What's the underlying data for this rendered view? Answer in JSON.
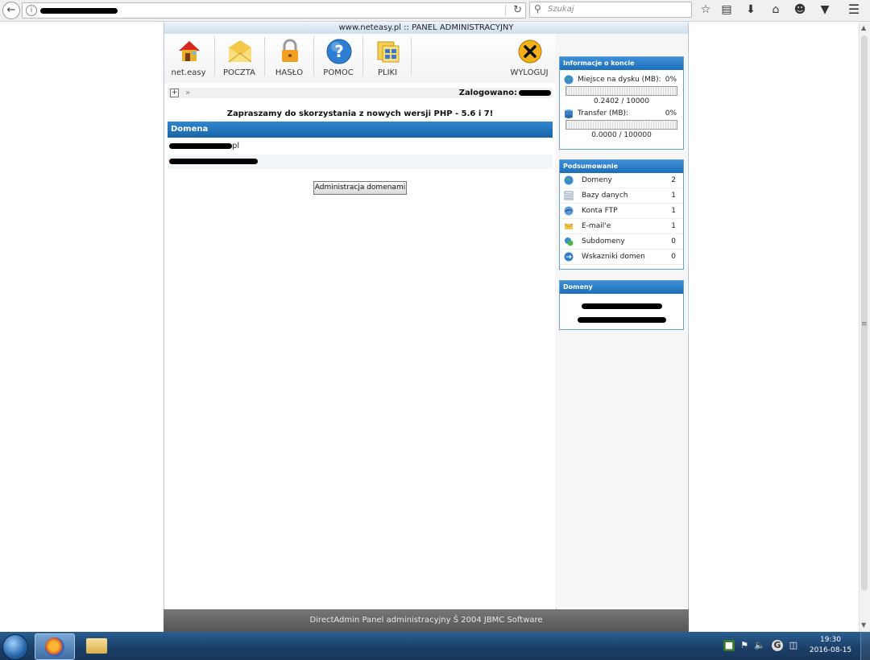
{
  "browser": {
    "search_placeholder": "Szukaj"
  },
  "panel": {
    "header": "www.neteasy.pl :: PANEL ADMINISTRACYJNY",
    "toolbar": {
      "neteasy": "net.easy",
      "mail": "POCZTA",
      "password": "HASŁO",
      "help": "POMOC",
      "files": "PLIKI",
      "logout": "WYLOGUJ"
    },
    "breadcrumb_arrow": "»",
    "logged_in": "Zalogowano:",
    "promo": "Zapraszamy do skorzystania z nowych wersji PHP - 5.6 i 7!",
    "domain_header": "Domena",
    "domain_suffix": "pl",
    "admin_button": "Administracja domenami"
  },
  "sidebar": {
    "account_info": {
      "title": "Informacje o koncie",
      "disk_label": "Miejsce na dysku (MB):",
      "disk_pct": "0%",
      "disk_fill": 0,
      "disk_value": "0.2402 / 10000",
      "transfer_label": "Transfer (MB):",
      "transfer_pct": "0%",
      "transfer_fill": 0,
      "transfer_value": "0.0000 / 100000"
    },
    "summary": {
      "title": "Podsumowanie",
      "items": [
        {
          "name": "Domeny",
          "count": "2",
          "icon": "globe-icon"
        },
        {
          "name": "Bazy danych",
          "count": "1",
          "icon": "database-icon"
        },
        {
          "name": "Konta FTP",
          "count": "1",
          "icon": "ftp-icon"
        },
        {
          "name": "E-mail'e",
          "count": "1",
          "icon": "email-icon"
        },
        {
          "name": "Subdomeny",
          "count": "0",
          "icon": "subdomain-icon"
        },
        {
          "name": "Wskazniki domen",
          "count": "0",
          "icon": "domain-pointer-icon"
        }
      ]
    },
    "domains": {
      "title": "Domeny"
    }
  },
  "footer": "DirectAdmin Panel administracyjny Š 2004 JBMC Software",
  "taskbar": {
    "time": "19:30",
    "date": "2016-08-15"
  },
  "colors": {
    "header_blue": "#1d6fba",
    "footer_gray": "#555555"
  }
}
